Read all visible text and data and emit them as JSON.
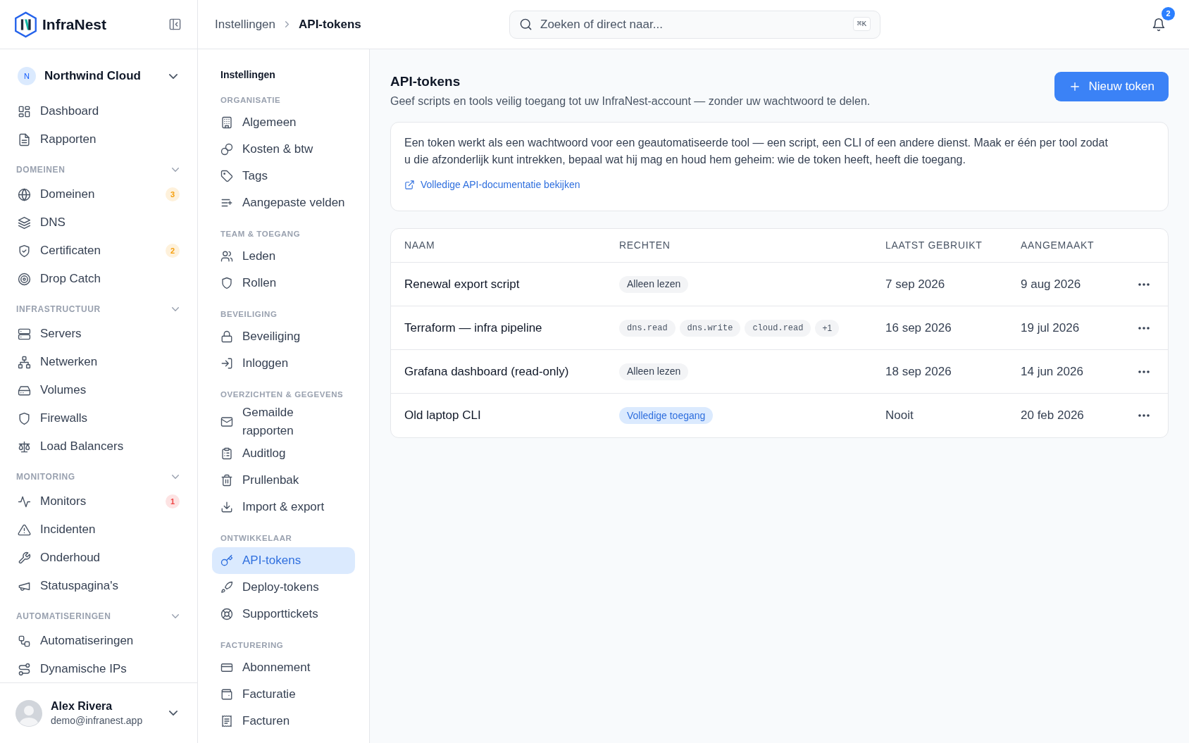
{
  "brand": {
    "name": "InfraNest"
  },
  "org_switcher": {
    "avatar": "N",
    "name": "Northwind Cloud"
  },
  "sidebar": {
    "items": [
      {
        "label": "Dashboard"
      },
      {
        "label": "Rapporten"
      }
    ],
    "sections": [
      {
        "title": "DOMEINEN",
        "expanded": true,
        "items": [
          {
            "label": "Domeinen",
            "badge": "3",
            "color": "#f59e0b"
          },
          {
            "label": "DNS"
          },
          {
            "label": "Certificaten",
            "badge": "2",
            "color": "#f59e0b"
          },
          {
            "label": "Drop Catch"
          }
        ]
      },
      {
        "title": "INFRASTRUCTUUR",
        "expanded": true,
        "items": [
          {
            "label": "Servers"
          },
          {
            "label": "Netwerken"
          },
          {
            "label": "Volumes"
          },
          {
            "label": "Firewalls"
          },
          {
            "label": "Load Balancers"
          }
        ]
      },
      {
        "title": "MONITORING",
        "expanded": true,
        "items": [
          {
            "label": "Monitors",
            "badge": "1",
            "color": "#ef4444"
          },
          {
            "label": "Incidenten"
          },
          {
            "label": "Onderhoud"
          },
          {
            "label": "Statuspagina's"
          }
        ]
      },
      {
        "title": "AUTOMATISERINGEN",
        "expanded": true,
        "items": [
          {
            "label": "Automatiseringen"
          },
          {
            "label": "Dynamische IPs"
          }
        ]
      }
    ]
  },
  "user": {
    "name": "Alex Rivera",
    "email": "demo@infranest.app"
  },
  "breadcrumb": [
    {
      "label": "Instellingen"
    },
    {
      "label": "API-tokens"
    }
  ],
  "search": {
    "placeholder": "Zoeken of direct naar...",
    "shortcut": "⌘K"
  },
  "notifications": {
    "count": "2"
  },
  "settings_nav": {
    "title": "Instellingen",
    "sections": [
      {
        "title": "ORGANISATIE",
        "items": [
          {
            "label": "Algemeen",
            "selected": false
          },
          {
            "label": "Kosten & btw",
            "selected": false
          },
          {
            "label": "Tags",
            "selected": false
          },
          {
            "label": "Aangepaste velden",
            "selected": false
          }
        ]
      },
      {
        "title": "TEAM & TOEGANG",
        "items": [
          {
            "label": "Leden",
            "selected": false
          },
          {
            "label": "Rollen",
            "selected": false
          }
        ]
      },
      {
        "title": "BEVEILIGING",
        "items": [
          {
            "label": "Beveiliging",
            "selected": false
          },
          {
            "label": "Inloggen",
            "selected": false
          }
        ]
      },
      {
        "title": "OVERZICHTEN & GEGEVENS",
        "items": [
          {
            "label": "Gemailde rapporten",
            "selected": false
          },
          {
            "label": "Auditlog",
            "selected": false
          },
          {
            "label": "Prullenbak",
            "selected": false
          },
          {
            "label": "Import & export",
            "selected": false
          }
        ]
      },
      {
        "title": "ONTWIKKELAAR",
        "items": [
          {
            "label": "API-tokens",
            "selected": true
          },
          {
            "label": "Deploy-tokens",
            "selected": false
          },
          {
            "label": "Supporttickets",
            "selected": false
          }
        ]
      },
      {
        "title": "FACTURERING",
        "items": [
          {
            "label": "Abonnement",
            "selected": false
          },
          {
            "label": "Facturatie",
            "selected": false
          },
          {
            "label": "Facturen",
            "selected": false
          }
        ]
      }
    ]
  },
  "page": {
    "title": "API-tokens",
    "subtitle": "Geef scripts en tools veilig toegang tot uw InfraNest-account — zonder uw wachtwoord te delen.",
    "new_button": "Nieuw token"
  },
  "info_card": {
    "text": "Een token werkt als een wachtwoord voor een geautomatiseerde tool — een script, een CLI of een andere dienst. Maak er één per tool zodat u die afzonderlijk kunt intrekken, bepaal wat hij mag en houd hem geheim: wie de token heeft, heeft die toegang.",
    "link": "Volledige API-documentatie bekijken"
  },
  "table": {
    "columns": [
      "NAAM",
      "RECHTEN",
      "LAATST GEBRUIKT",
      "AANGEMAAKT"
    ],
    "rows": [
      {
        "name": "Renewal export script",
        "rights": [
          {
            "kind": "level",
            "label": "Alleen lezen"
          }
        ],
        "last_used": "7 sep 2026",
        "created": "9 aug 2026"
      },
      {
        "name": "Terraform — infra pipeline",
        "rights": [
          {
            "kind": "scope",
            "label": "dns.read"
          },
          {
            "kind": "scope",
            "label": "dns.write"
          },
          {
            "kind": "scope",
            "label": "cloud.read"
          },
          {
            "kind": "more",
            "label": "+1"
          }
        ],
        "last_used": "16 sep 2026",
        "created": "19 jul 2026"
      },
      {
        "name": "Grafana dashboard (read-only)",
        "rights": [
          {
            "kind": "level",
            "label": "Alleen lezen"
          }
        ],
        "last_used": "18 sep 2026",
        "created": "14 jun 2026"
      },
      {
        "name": "Old laptop CLI",
        "rights": [
          {
            "kind": "full",
            "label": "Volledige toegang"
          }
        ],
        "last_used": "Nooit",
        "created": "20 feb 2026"
      }
    ]
  }
}
